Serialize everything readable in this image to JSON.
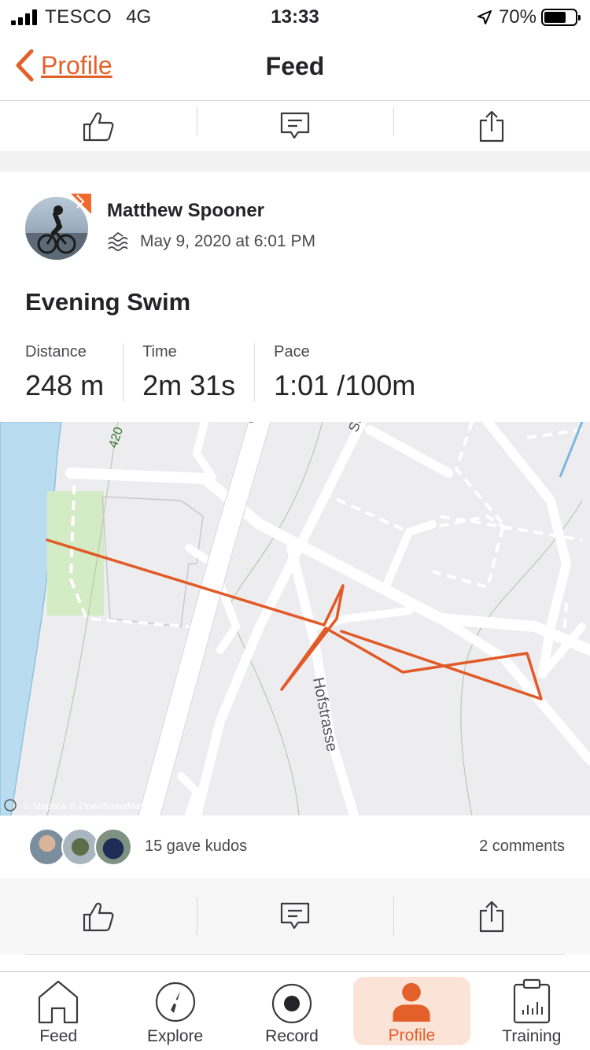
{
  "status_bar": {
    "carrier": "TESCO",
    "network": "4G",
    "time": "13:33",
    "battery": "70%",
    "battery_level": 0.7
  },
  "nav": {
    "back_label": "Profile",
    "title": "Feed"
  },
  "activity": {
    "athlete_name": "Matthew Spooner",
    "datetime": "May 9, 2020 at 6:01 PM",
    "sport_icon": "swim-icon",
    "title": "Evening Swim",
    "stats": [
      {
        "label": "Distance",
        "value": "248 m"
      },
      {
        "label": "Time",
        "value": "2m 31s"
      },
      {
        "label": "Pace",
        "value": "1:01 /100m"
      }
    ],
    "map": {
      "street_labels": [
        "Hofstrasse",
        "420"
      ],
      "attribution": "© Mapbox © OpenStreetMap"
    },
    "kudos_text": "15 gave kudos",
    "comments_text": "2 comments"
  },
  "tabs": [
    {
      "label": "Feed",
      "icon": "home-icon"
    },
    {
      "label": "Explore",
      "icon": "compass-icon"
    },
    {
      "label": "Record",
      "icon": "record-icon"
    },
    {
      "label": "Profile",
      "icon": "person-icon"
    },
    {
      "label": "Training",
      "icon": "calendar-chart-icon"
    }
  ],
  "colors": {
    "accent": "#e4602a",
    "route": "#e15a28",
    "water": "#b9dcf0",
    "park": "#d4ecc6",
    "active_tab_bg": "#fbe3d8"
  }
}
